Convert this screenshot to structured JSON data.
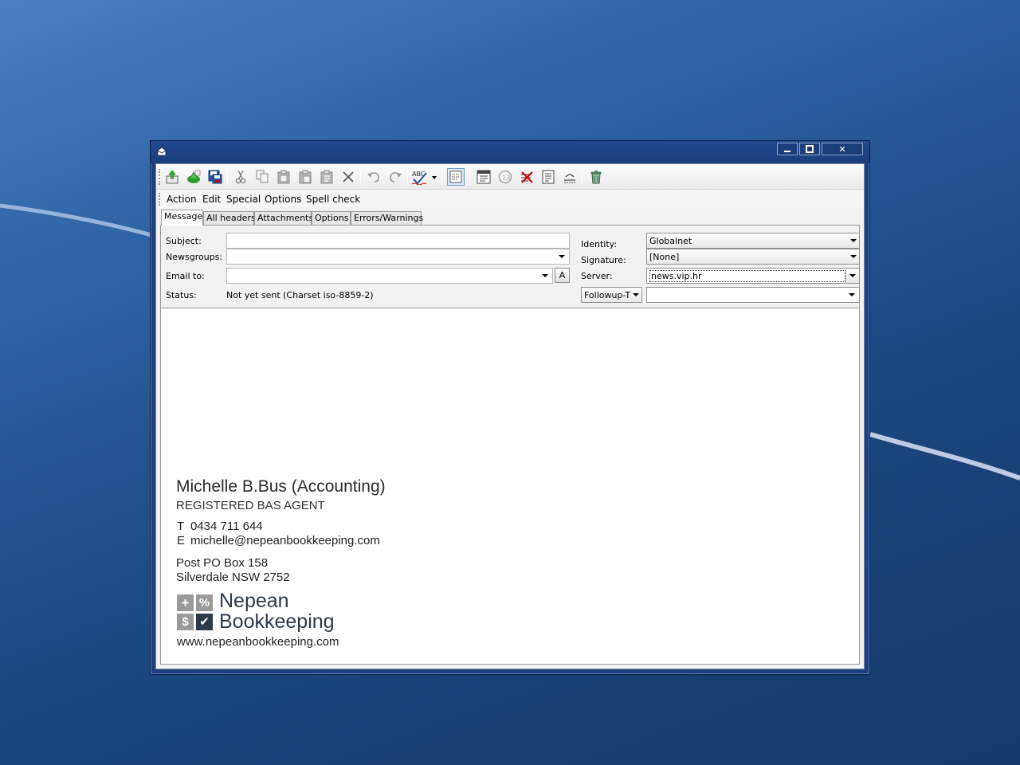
{
  "window": {
    "close_glyph": "✕"
  },
  "toolbar": {
    "buttons": [
      "send-icon",
      "send-later-icon",
      "save-draft-icon",
      "cut-icon",
      "copy-icon",
      "paste-icon",
      "paste-quote-icon",
      "paste-special-icon",
      "delete-icon",
      "undo-icon",
      "redo-icon",
      "spell-check-icon",
      "word-wrap-icon",
      "insert-header-icon",
      "rot13-icon",
      "remove-icon",
      "insert-file-icon",
      "reflow-icon",
      "discard-icon"
    ]
  },
  "menu": {
    "items": [
      "Action",
      "Edit",
      "Special",
      "Options",
      "Spell check"
    ]
  },
  "tabs": [
    {
      "label": "Message",
      "active": true
    },
    {
      "label": "All headers",
      "active": false
    },
    {
      "label": "Attachments",
      "active": false
    },
    {
      "label": "Options",
      "active": false
    },
    {
      "label": "Errors/Warnings",
      "active": false
    }
  ],
  "form": {
    "subject_label": "Subject:",
    "subject_value": "",
    "newsgroups_label": "Newsgroups:",
    "newsgroups_value": "",
    "emailto_label": "Email to:",
    "emailto_value": "",
    "address_button": "A",
    "status_label": "Status:",
    "status_value": "Not yet sent (Charset iso-8859-2)",
    "identity_label": "Identity:",
    "identity_value": "Globalnet",
    "signature_label": "Signature:",
    "signature_value": "[None]",
    "server_label": "Server:",
    "server_value": "news.vip.hr",
    "followup_label": "Followup-T",
    "followup_value": ""
  },
  "signature": {
    "name": "Michelle B.Bus (Accounting)",
    "title": "REGISTERED BAS AGENT",
    "phone_prefix": "T",
    "phone": "0434 711 644",
    "email_prefix": "E",
    "email": "michelle@nepeanbookkeeping.com",
    "address1": "Post PO Box 158",
    "address2": "Silverdale NSW 2752",
    "logo_line1": "Nepean",
    "logo_line2": "Bookkeeping",
    "logo_symbols": [
      "+",
      "%",
      "$",
      "✔"
    ],
    "website": "www.nepeanbookkeeping.com",
    "brand_color": "#2d3a4a",
    "logo_grey": "#9a9a9a"
  }
}
